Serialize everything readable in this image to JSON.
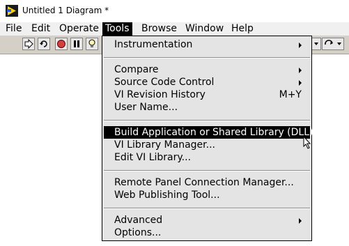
{
  "window": {
    "title": "Untitled 1 Diagram *"
  },
  "menubar": {
    "items": [
      {
        "label": "File"
      },
      {
        "label": "Edit"
      },
      {
        "label": "Operate"
      },
      {
        "label": "Tools"
      },
      {
        "label": "Browse"
      },
      {
        "label": "Window"
      },
      {
        "label": "Help"
      }
    ]
  },
  "toolbar": {
    "buttons": [
      "run-arrow-icon",
      "run-continuously-icon",
      "abort-icon",
      "pause-icon",
      "highlight-execution-icon"
    ]
  },
  "tools_menu": {
    "items": [
      {
        "label": "Instrumentation",
        "submenu": true
      },
      {
        "label": "Compare",
        "submenu": true
      },
      {
        "label": "Source Code Control",
        "submenu": true
      },
      {
        "label": "VI Revision History",
        "shortcut": "M+Y"
      },
      {
        "label": "User Name..."
      },
      {
        "label": "Build Application or Shared Library (DLL)...",
        "highlighted": true
      },
      {
        "label": "VI Library Manager..."
      },
      {
        "label": "Edit VI Library..."
      },
      {
        "label": "Remote Panel Connection Manager..."
      },
      {
        "label": "Web Publishing Tool..."
      },
      {
        "label": "Advanced",
        "submenu": true
      },
      {
        "label": "Options..."
      }
    ]
  },
  "colors": {
    "menu_bg": "#e4e4e4",
    "highlight": "#000000",
    "toolbar_bg": "#d4d0c8"
  }
}
